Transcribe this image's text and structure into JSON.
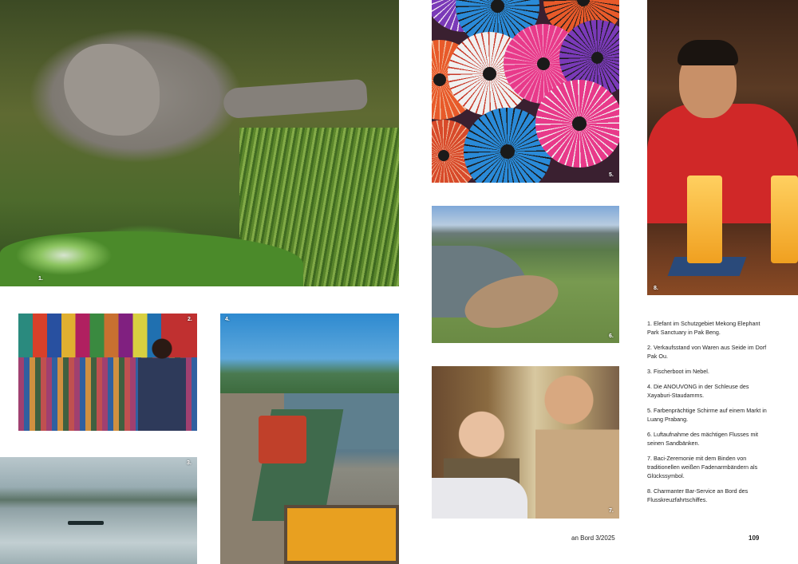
{
  "photos": [
    {
      "number": "1.",
      "subject": "elephant"
    },
    {
      "number": "2.",
      "subject": "silk-stall"
    },
    {
      "number": "3.",
      "subject": "fishing-boat-fog"
    },
    {
      "number": "4.",
      "subject": "ship-lock"
    },
    {
      "number": "5.",
      "subject": "umbrellas"
    },
    {
      "number": "6.",
      "subject": "aerial-river"
    },
    {
      "number": "7.",
      "subject": "baci-ceremony"
    },
    {
      "number": "8.",
      "subject": "bar-service"
    }
  ],
  "captions": [
    "1. Elefant im Schutzgebiet Mekong Elephant Park Sanctuary in Pak Beng.",
    "2. Verkaufsstand von Waren aus Seide im Dorf Pak Ou.",
    "3. Fischerboot im Nebel.",
    "4. Die ANOUVONG in der Schleuse des Xayaburi-Staudamms.",
    "5. Farbenprächtige Schirme auf einem Markt in Luang Prabang.",
    "6. Luftaufnahme des mächtigen Flusses mit seinen Sandbänken.",
    "7. Baci-Zeremonie mit dem Binden von traditionellen weißen Fadenarmbändern als Glückssymbol.",
    "8. Charmanter Bar-Service an Bord des Flusskreuzfahrtschiffes."
  ],
  "footer": {
    "magazine": "an Bord 3/2025",
    "page": "109"
  },
  "umbrella_colors": [
    "#e85a2a",
    "#2a8ad8",
    "#e83a8a",
    "#7a3ab8",
    "#f0f0f0",
    "#d84a2a"
  ]
}
